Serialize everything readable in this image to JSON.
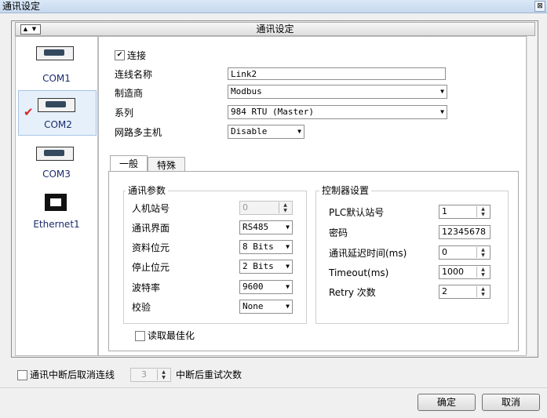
{
  "window": {
    "title": "通讯设定",
    "close_glyph": "⊠"
  },
  "panel_title": "通讯设定",
  "ports": [
    "COM1",
    "COM2",
    "COM3",
    "Ethernet1"
  ],
  "selected_port": "COM2",
  "connect": {
    "label": "连接",
    "checked": true
  },
  "form": {
    "name_label": "连线名称",
    "name_value": "Link2",
    "maker_label": "制造商",
    "maker_value": "Modbus",
    "series_label": "系列",
    "series_value": "984 RTU (Master)",
    "multi_label": "网路多主机",
    "multi_value": "Disable"
  },
  "tabs": [
    "一般",
    "特殊"
  ],
  "comm": {
    "title": "通讯参数",
    "station_label": "人机站号",
    "station_value": "0",
    "iface_label": "通讯界面",
    "iface_value": "RS485",
    "data_label": "资料位元",
    "data_value": "8 Bits",
    "stop_label": "停止位元",
    "stop_value": "2 Bits",
    "baud_label": "波特率",
    "baud_value": "9600",
    "parity_label": "校验",
    "parity_value": "None"
  },
  "ctrl": {
    "title": "控制器设置",
    "plc_label": "PLC默认站号",
    "plc_value": "1",
    "pw_label": "密码",
    "pw_value": "12345678",
    "delay_label": "通讯延迟时间(ms)",
    "delay_value": "0",
    "timeout_label": "Timeout(ms)",
    "timeout_value": "1000",
    "retry_label": "Retry 次数",
    "retry_value": "2"
  },
  "optimize": {
    "label": "读取最佳化",
    "checked": false
  },
  "bottom": {
    "cancel_link_label": "通讯中断后取消连线",
    "retry_count": "3",
    "retry_label": "中断后重试次数"
  },
  "buttons": {
    "ok": "确定",
    "cancel": "取消"
  },
  "colors": {
    "check_mark": "#d2272a",
    "port_label": "#1a2b6d"
  }
}
